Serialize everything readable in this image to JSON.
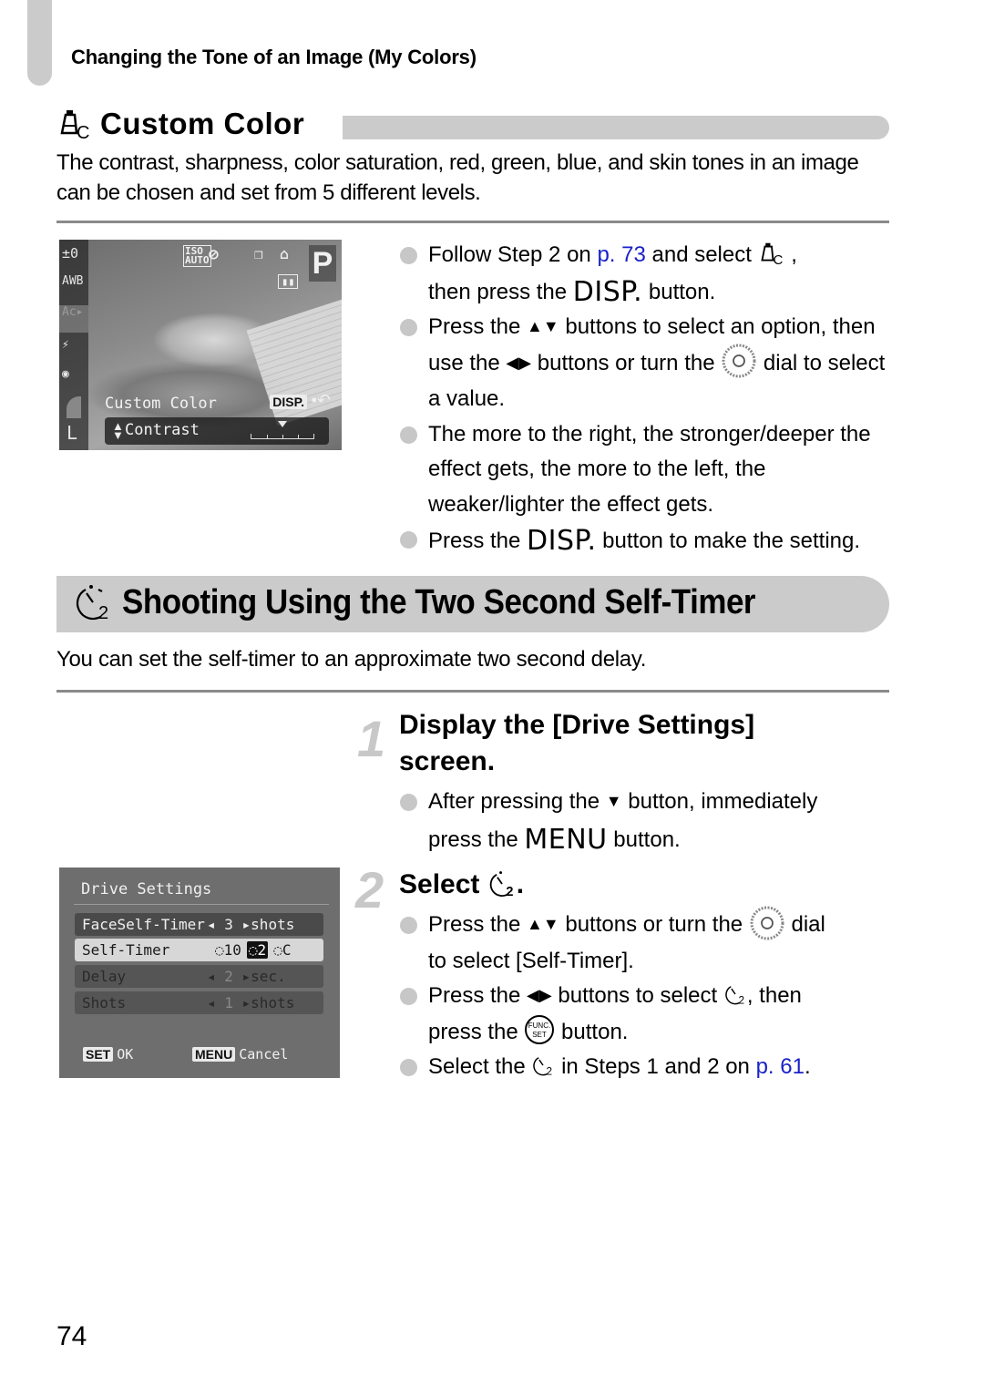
{
  "running_head": "Changing the Tone of an Image (My Colors)",
  "custom_color": {
    "icon": "custom-color-icon",
    "title": "Custom Color",
    "intro": "The contrast, sharpness, color saturation, red, green, blue, and skin tones in an image can be chosen and set from 5 different levels.",
    "screen": {
      "left_column": [
        "±0",
        "AWB",
        "Ac",
        "flash-comp",
        "metering",
        "quality",
        "L"
      ],
      "top_icons": [
        "ISO AUTO",
        "flash-off",
        "drive",
        "self-timer",
        "battery"
      ],
      "mode": "P",
      "menu_label": "Custom Color",
      "disp_key": "DISP.",
      "option": "Contrast",
      "level": 3,
      "levels_total": 5
    },
    "bullets": [
      {
        "before": "Follow Step 2 on ",
        "link": "p. 73",
        "after": " and select ",
        "after2": " ,",
        "line2_before": "then press the ",
        "key": "DISP.",
        "line2_after": " button."
      },
      {
        "before": "Press the ",
        "arrows": "▲▼",
        "mid": " buttons to select an option, then use the ",
        "arrows2": "◀▶",
        "mid2": " buttons or turn the ",
        "after": " dial to select a value."
      },
      {
        "text": "The more to the right, the stronger/deeper the effect gets, the more to the left, the weaker/lighter the effect gets."
      },
      {
        "before": "Press the ",
        "key": "DISP.",
        "after": " button to make the setting."
      }
    ]
  },
  "self_timer": {
    "title": "Shooting Using the Two Second Self-Timer",
    "intro": "You can set the self-timer to an approximate two second delay.",
    "steps": [
      {
        "number": "1",
        "title_line1": "Display the [Drive Settings]",
        "title_line2": "screen.",
        "bullets": [
          {
            "before": "After pressing the ",
            "arrow": "▼",
            "after": " button, immediately",
            "line2_before": "press the ",
            "key": "MENU",
            "line2_after": " button."
          }
        ]
      },
      {
        "number": "2",
        "title": "Select",
        "title_end": ".",
        "bullets": [
          {
            "before": "Press the ",
            "arrows": "▲▼",
            "mid": " buttons or turn the ",
            "after": " dial",
            "line2": "to select [Self-Timer]."
          },
          {
            "before": "Press the ",
            "arrows": "◀▶",
            "mid": " buttons to select ",
            "after": ", then",
            "line2_before": "press the ",
            "line2_after": " button."
          },
          {
            "before": "Select the ",
            "mid": " in Steps 1 and 2 on ",
            "link": "p. 61",
            "after": "."
          }
        ]
      }
    ],
    "screen": {
      "title": "Drive Settings",
      "rows": [
        {
          "label": "FaceSelf-Timer",
          "value": "3",
          "unit": "shots"
        },
        {
          "label": "Self-Timer",
          "options": [
            "10",
            "2",
            "C"
          ],
          "selected": "2"
        },
        {
          "label": "Delay",
          "value": "2",
          "unit": "sec."
        },
        {
          "label": "Shots",
          "value": "1",
          "unit": "shots"
        }
      ],
      "ok_key": "SET",
      "ok_label": "OK",
      "cancel_key": "MENU",
      "cancel_label": "Cancel"
    }
  },
  "page_number": "74",
  "colors": {
    "link": "#1a22c8",
    "heading_bar": "#cbcbcb",
    "bullet": "#c7c7c7"
  }
}
